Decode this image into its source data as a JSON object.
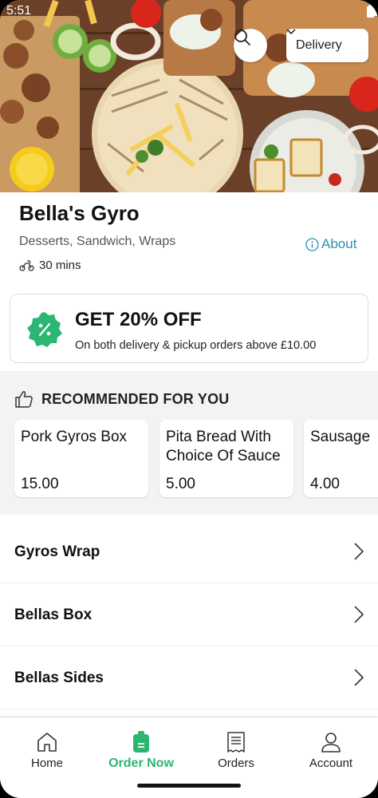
{
  "status": {
    "time": "5:51"
  },
  "header": {
    "delivery_label": "Delivery"
  },
  "restaurant": {
    "name": "Bella's Gyro",
    "categories": "Desserts, Sandwich, Wraps",
    "about_label": "About",
    "eta": "30 mins"
  },
  "promo": {
    "title": "GET 20% OFF",
    "subtitle": "On both delivery & pickup orders above £10.00",
    "badge_color": "#2bb673"
  },
  "recommended": {
    "heading": "RECOMMENDED FOR YOU",
    "items": [
      {
        "name_line1": "Pork Gyros Box",
        "name_line2": "",
        "price": "15.00"
      },
      {
        "name_line1": "Pita Bread With",
        "name_line2": "Choice Of Sauce",
        "price": "5.00"
      },
      {
        "name_line1": "Sausage",
        "name_line2": "",
        "price": "4.00"
      }
    ]
  },
  "menu_categories": [
    {
      "label": "Gyros Wrap"
    },
    {
      "label": "Bellas Box"
    },
    {
      "label": "Bellas Sides"
    }
  ],
  "bottom_nav": {
    "items": [
      {
        "label": "Home",
        "icon": "home-icon"
      },
      {
        "label": "Order Now",
        "icon": "order-bag-icon",
        "active": true
      },
      {
        "label": "Orders",
        "icon": "receipt-icon"
      },
      {
        "label": "Account",
        "icon": "account-icon"
      }
    ]
  },
  "colors": {
    "accent": "#2bb673",
    "link": "#2d8fb3"
  }
}
